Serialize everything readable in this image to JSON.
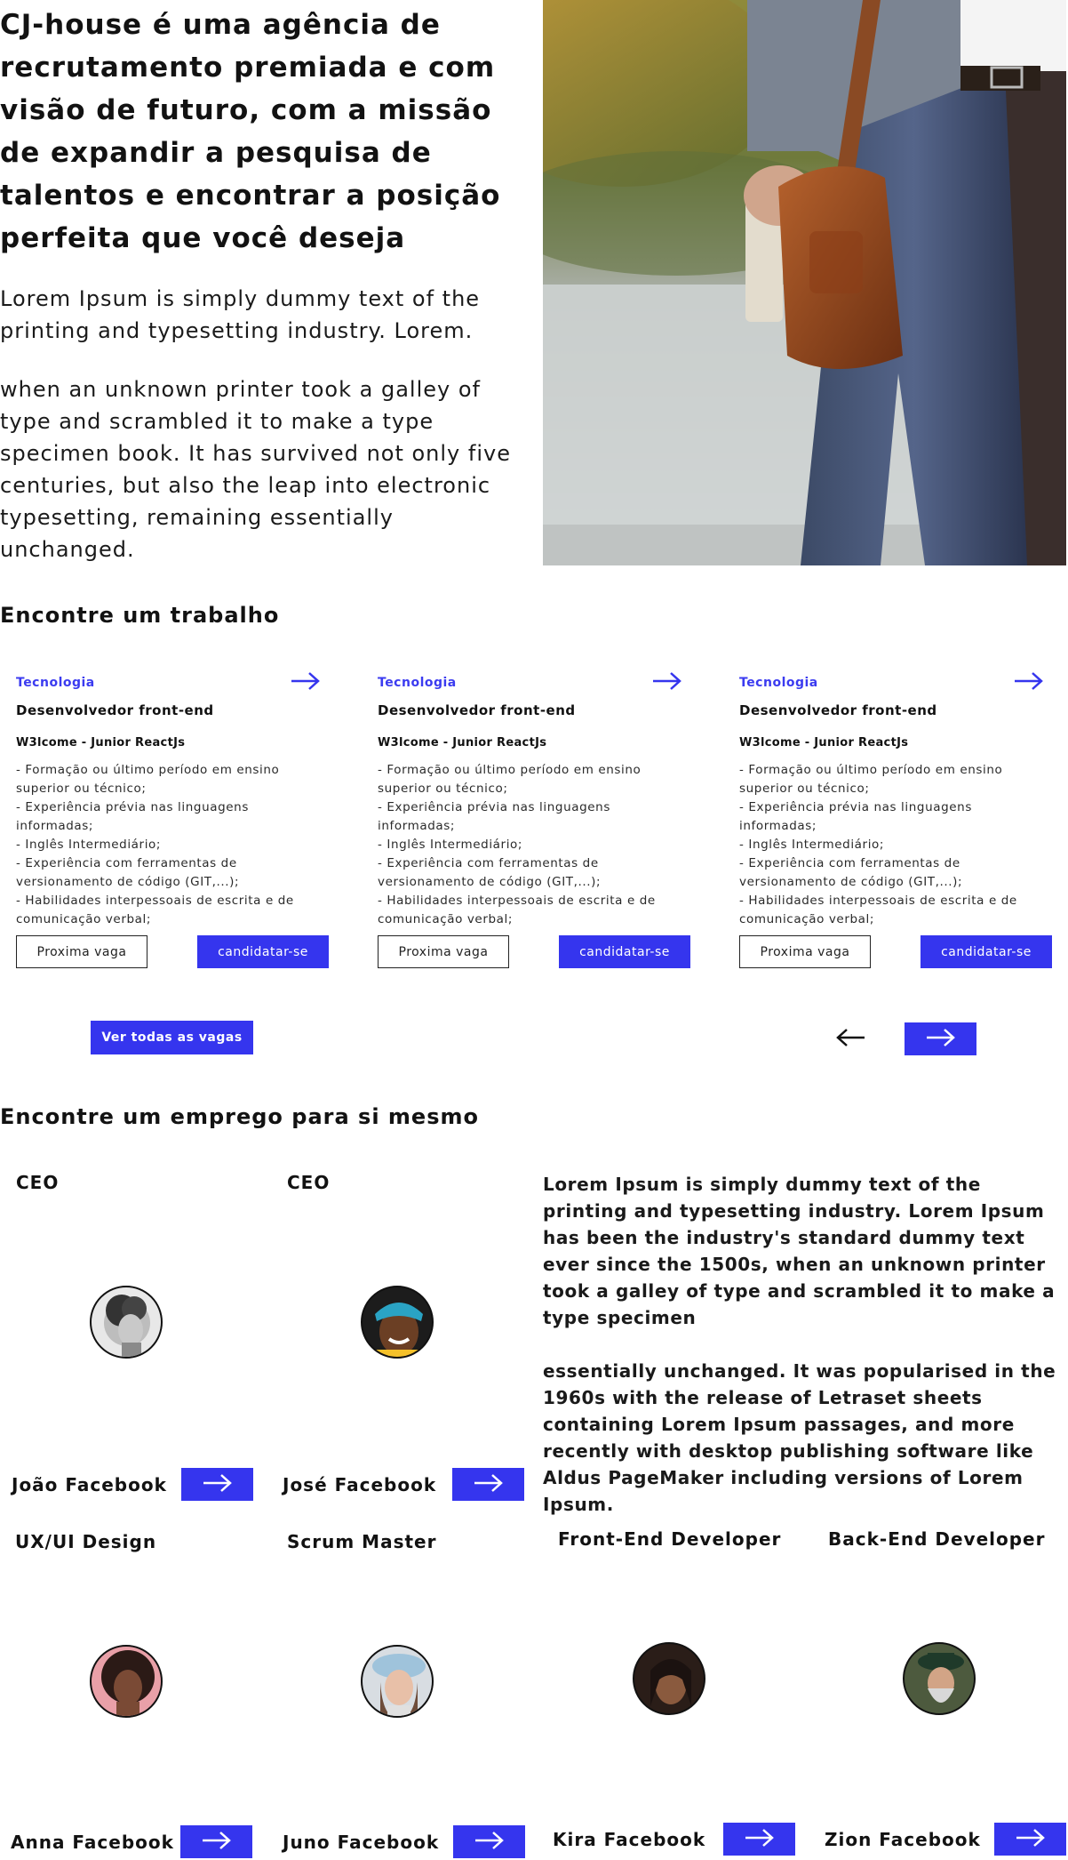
{
  "hero": {
    "title": "CJ-house é uma agência de recrutamento premiada e com visão de futuro, com a missão de expandir a pesquisa de talentos e encontrar a posição perfeita que você deseja",
    "paragraph1": "Lorem Ipsum is simply dummy text of the printing and typesetting industry. Lorem.",
    "paragraph2": "when an unknown printer took a galley of type and scrambled it to make a type specimen book. It has survived not only five centuries, but also the leap into electronic typesetting, remaining essentially unchanged."
  },
  "jobs_section": {
    "title": "Encontre um trabalho",
    "cards": [
      {
        "category": "Tecnologia",
        "title": "Desenvolvedor front-end",
        "subtitle": "W3lcome - Junior ReactJs",
        "requirements": "- Formação ou último período em ensino superior ou técnico;\n- Experiência prévia nas linguagens informadas;\n- Inglês Intermediário;\n- Experiência com ferramentas de versionamento de código (GIT,...);\n- Habilidades interpessoais de escrita e de comunicação verbal;",
        "next_label": "Proxima vaga",
        "apply_label": "candidatar-se"
      },
      {
        "category": "Tecnologia",
        "title": "Desenvolvedor front-end",
        "subtitle": "W3lcome - Junior ReactJs",
        "requirements": "- Formação ou último período em ensino superior ou técnico;\n- Experiência prévia nas linguagens informadas;\n- Inglês Intermediário;\n- Experiência com ferramentas de versionamento de código (GIT,...);\n- Habilidades interpessoais de escrita e de comunicação verbal;",
        "next_label": "Proxima vaga",
        "apply_label": "candidatar-se"
      },
      {
        "category": "Tecnologia",
        "title": "Desenvolvedor front-end",
        "subtitle": "W3lcome - Junior ReactJs",
        "requirements": "- Formação ou último período em ensino superior ou técnico;\n- Experiência prévia nas linguagens informadas;\n- Inglês Intermediário;\n- Experiência com ferramentas de versionamento de código (GIT,...);\n- Habilidades interpessoais de escrita e de comunicação verbal;",
        "next_label": "Proxima vaga",
        "apply_label": "candidatar-se"
      }
    ],
    "view_all_label": "Ver todas as vagas"
  },
  "people_section": {
    "title": "Encontre um emprego para si mesmo",
    "people": [
      {
        "role": "CEO",
        "name": "João Facebook"
      },
      {
        "role": "CEO",
        "name": "José Facebook"
      },
      {
        "role": "UX/UI Design",
        "name": "Anna Facebook"
      },
      {
        "role": "Scrum Master",
        "name": "Juno Facebook"
      },
      {
        "role": "Front-End Developer",
        "name": "Kira Facebook"
      },
      {
        "role": "Back-End Developer",
        "name": "Zion Facebook"
      }
    ],
    "lorem1": "Lorem Ipsum is simply dummy text of the printing and typesetting industry. Lorem Ipsum has been the industry's standard dummy text ever since the 1500s, when an unknown printer took a galley of type and scrambled it to make a type specimen",
    "lorem2": "essentially unchanged. It was popularised in the 1960s with the release of Letraset sheets containing Lorem Ipsum passages, and more recently with desktop publishing software like Aldus PageMaker including versions of Lorem Ipsum."
  },
  "colors": {
    "accent": "#3535ee",
    "text": "#121212"
  },
  "icons": {
    "arrow_right": "arrow-right-icon",
    "arrow_left": "arrow-left-icon"
  }
}
